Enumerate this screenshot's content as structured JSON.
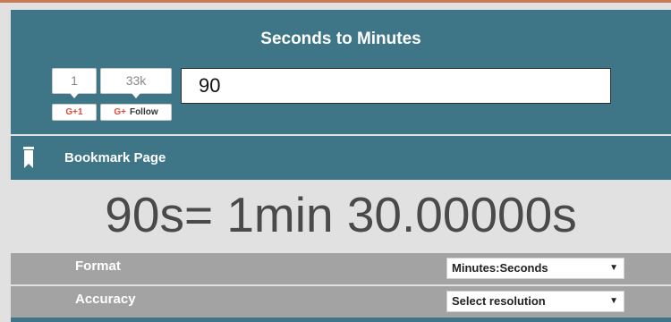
{
  "header": {
    "title": "Seconds to Minutes"
  },
  "social": {
    "gplus_count": "1",
    "gplus_label": "G+1",
    "follow_count": "33k",
    "follow_label": "Follow",
    "follow_g": "G+"
  },
  "input": {
    "value": "90"
  },
  "bookmark": {
    "label": "Bookmark Page"
  },
  "result": {
    "text": "90s= 1min 30.00000s"
  },
  "format": {
    "label": "Format",
    "selected": "Minutes:Seconds"
  },
  "accuracy": {
    "label": "Accuracy",
    "selected": "Select resolution"
  },
  "colors": {
    "panel": "#3e7688",
    "row": "#a3a3a3",
    "accent": "#dd4b39"
  }
}
